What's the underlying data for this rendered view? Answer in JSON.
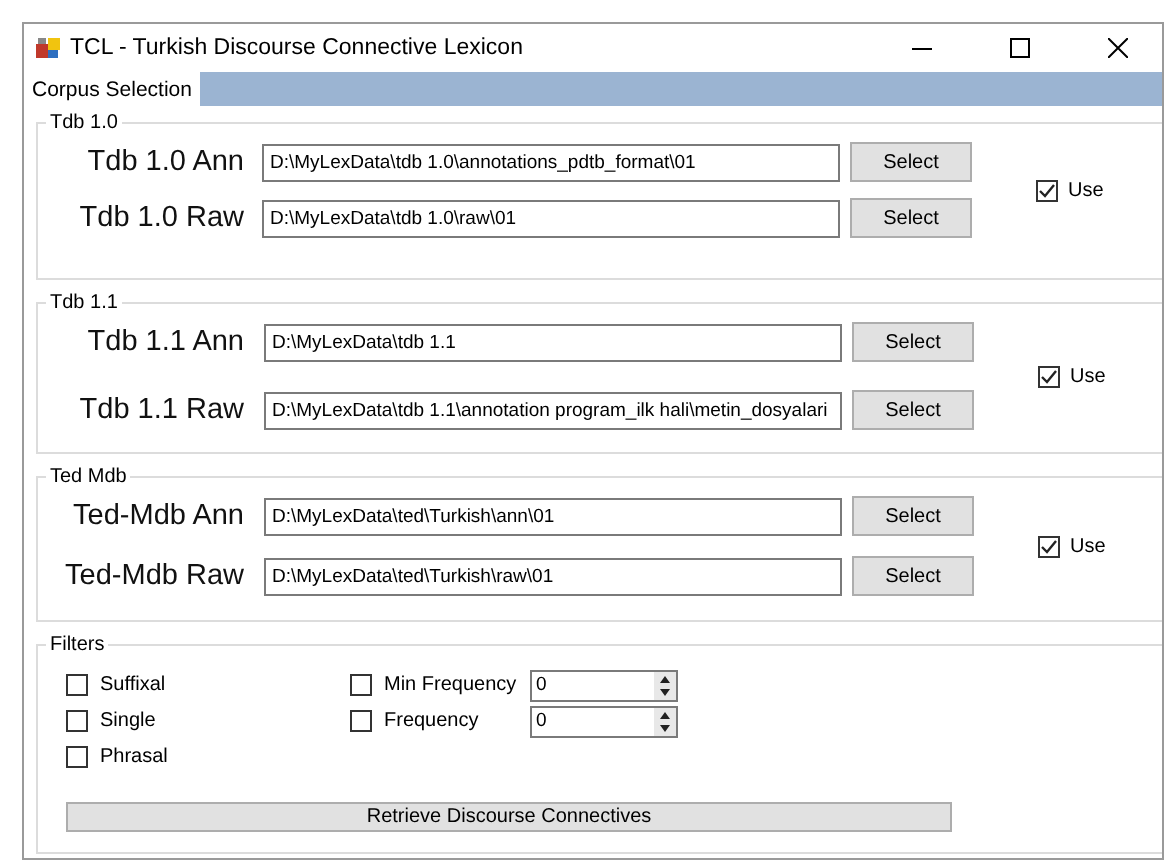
{
  "window": {
    "title": "TCL - Turkish Discourse Connective Lexicon"
  },
  "tabs": [
    {
      "label": "Corpus Selection",
      "selected": true
    }
  ],
  "groups": [
    {
      "title": "Tdb 1.0",
      "use": {
        "label": "Use",
        "checked": true
      },
      "rows": [
        {
          "label": "Tdb 1.0 Ann",
          "path": "D:\\MyLexData\\tdb 1.0\\annotations_pdtb_format\\01",
          "button": "Select"
        },
        {
          "label": "Tdb 1.0 Raw",
          "path": "D:\\MyLexData\\tdb 1.0\\raw\\01",
          "button": "Select"
        }
      ]
    },
    {
      "title": "Tdb 1.1",
      "use": {
        "label": "Use",
        "checked": true
      },
      "rows": [
        {
          "label": "Tdb 1.1 Ann",
          "path": "D:\\MyLexData\\tdb 1.1",
          "button": "Select"
        },
        {
          "label": "Tdb 1.1 Raw",
          "path": "D:\\MyLexData\\tdb 1.1\\annotation program_ilk hali\\metin_dosyalari",
          "button": "Select"
        }
      ]
    },
    {
      "title": "Ted Mdb",
      "use": {
        "label": "Use",
        "checked": true
      },
      "rows": [
        {
          "label": "Ted-Mdb Ann",
          "path": "D:\\MyLexData\\ted\\Turkish\\ann\\01",
          "button": "Select"
        },
        {
          "label": "Ted-Mdb Raw",
          "path": "D:\\MyLexData\\ted\\Turkish\\raw\\01",
          "button": "Select"
        }
      ]
    }
  ],
  "filters": {
    "title": "Filters",
    "type_options": [
      {
        "label": "Suffixal",
        "checked": false
      },
      {
        "label": "Single",
        "checked": false
      },
      {
        "label": "Phrasal",
        "checked": false
      }
    ],
    "frequency_options": [
      {
        "label": "Min Frequency",
        "checked": false,
        "value": "0"
      },
      {
        "label": "Frequency",
        "checked": false,
        "value": "0"
      }
    ],
    "button": "Retrieve Discourse Connectives"
  }
}
